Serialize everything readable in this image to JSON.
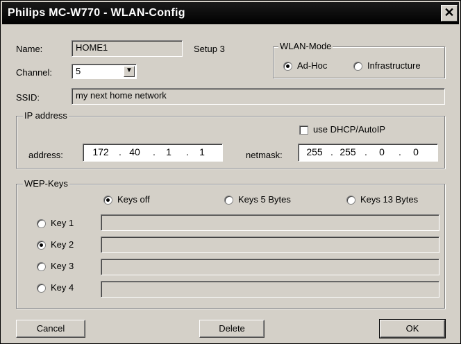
{
  "window": {
    "title": "Philips MC-W770 - WLAN-Config",
    "close_glyph": "✕"
  },
  "name": {
    "label": "Name:",
    "value": "HOME1",
    "setup_text": "Setup 3"
  },
  "channel": {
    "label": "Channel:",
    "value": "5"
  },
  "ssid": {
    "label": "SSID:",
    "value": "my next home network"
  },
  "wlan_mode": {
    "title": "WLAN-Mode",
    "options": [
      {
        "label": "Ad-Hoc",
        "selected": true
      },
      {
        "label": "Infrastructure",
        "selected": false
      }
    ]
  },
  "ip": {
    "title": "IP address",
    "dhcp_label": "use DHCP/AutoIP",
    "dhcp_checked": false,
    "address_label": "address:",
    "address": [
      "172",
      "40",
      "1",
      "1"
    ],
    "netmask_label": "netmask:",
    "netmask": [
      "255",
      "255",
      "0",
      "0"
    ]
  },
  "wep": {
    "title": "WEP-Keys",
    "modes": [
      {
        "label": "Keys off",
        "selected": true
      },
      {
        "label": "Keys 5 Bytes",
        "selected": false
      },
      {
        "label": "Keys 13 Bytes",
        "selected": false
      }
    ],
    "keys": [
      {
        "label": "Key 1",
        "selected": false,
        "value": ""
      },
      {
        "label": "Key 2",
        "selected": true,
        "value": ""
      },
      {
        "label": "Key 3",
        "selected": false,
        "value": ""
      },
      {
        "label": "Key 4",
        "selected": false,
        "value": ""
      }
    ]
  },
  "buttons": {
    "cancel": "Cancel",
    "delete": "Delete",
    "ok": "OK"
  }
}
